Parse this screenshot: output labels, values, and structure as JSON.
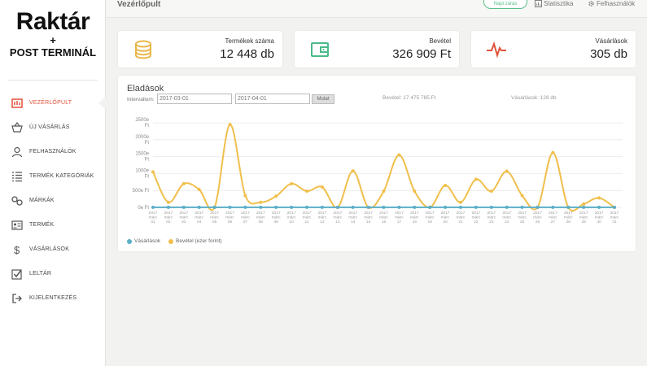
{
  "sidebar": {
    "logo_main": "Raktár",
    "logo_plus": "+",
    "logo_sub": "POST TERMINÁL",
    "items": [
      {
        "label": "VEZÉRLŐPULT",
        "icon": "dashboard-icon"
      },
      {
        "label": "ÚJ VÁSÁRLÁS",
        "icon": "basket-icon"
      },
      {
        "label": "FELHASZNÁLÓK",
        "icon": "user-icon"
      },
      {
        "label": "TERMÉK KATEGÓRIÁK",
        "icon": "list-icon"
      },
      {
        "label": "MÁRKÁK",
        "icon": "link-icon"
      },
      {
        "label": "TERMÉK",
        "icon": "id-card-icon"
      },
      {
        "label": "VÁSÁRLÁSOK",
        "icon": "dollar-icon"
      },
      {
        "label": "LELTÁR",
        "icon": "checkbox-icon"
      },
      {
        "label": "KIJELENTKEZÉS",
        "icon": "logout-icon"
      }
    ]
  },
  "topbar": {
    "title": "Vezérlőpult",
    "napi_zaras": "Napi zárás",
    "statisztika": "Statisztika",
    "felhasznalok": "Felhasználók"
  },
  "cards": [
    {
      "label": "Termékek száma",
      "value": "12 448 db",
      "icon": "coins-icon",
      "color": "#e8b84a"
    },
    {
      "label": "Bevétel",
      "value": "326 909 Ft",
      "icon": "wallet-icon",
      "color": "#4cb98a"
    },
    {
      "label": "Vásárlások",
      "value": "305 db",
      "icon": "pulse-icon",
      "color": "#e2523a"
    }
  ],
  "sales": {
    "title": "Eladások",
    "interval_label": "Intervallum:",
    "date_from": "2017-03-01",
    "date_to": "2017-04-01",
    "show_button": "Mutat",
    "revenue_summary": "Bevétel: 17 475 785 Ft",
    "purchases_summary": "Vásárlások: 128 db",
    "legend_purchases": "Vásárlások",
    "legend_revenue": "Bevétel (ezer forint)"
  },
  "chart_data": {
    "type": "line",
    "y_ticks": [
      "0e Ft",
      "500e Ft",
      "1000e Ft",
      "1500e Ft",
      "2000e Ft",
      "2500e Ft"
    ],
    "ylim": [
      0,
      2500
    ],
    "x": [
      "2017 márc 01",
      "2017 márc 02",
      "2017 márc 03",
      "2017 márc 04",
      "2017 márc 05",
      "2017 márc 06",
      "2017 márc 07",
      "2017 márc 08",
      "2017 márc 09",
      "2017 márc 10",
      "2017 márc 11",
      "2017 márc 12",
      "2017 márc 13",
      "2017 márc 14",
      "2017 márc 15",
      "2017 márc 16",
      "2017 márc 17",
      "2017 márc 18",
      "2017 márc 19",
      "2017 márc 20",
      "2017 márc 21",
      "2017 márc 22",
      "2017 márc 23",
      "2017 márc 24",
      "2017 márc 25",
      "2017 márc 26",
      "2017 márc 27",
      "2017 márc 28",
      "2017 márc 29",
      "2017 márc 30",
      "2017 márc 31"
    ],
    "tick_top": "2017",
    "tick_mid": "márc",
    "tick_days": [
      "01",
      "02",
      "03",
      "04",
      "05",
      "06",
      "07",
      "08",
      "09",
      "10",
      "11",
      "12",
      "13",
      "14",
      "15",
      "16",
      "17",
      "18",
      "19",
      "20",
      "21",
      "22",
      "23",
      "24",
      "25",
      "26",
      "27",
      "28",
      "29",
      "30",
      "31"
    ],
    "series": [
      {
        "name": "Vásárlások",
        "color": "#5aaec8",
        "values": [
          4,
          4,
          4,
          4,
          4,
          4,
          4,
          4,
          4,
          4,
          4,
          4,
          4,
          4,
          4,
          4,
          4,
          4,
          4,
          4,
          4,
          4,
          4,
          4,
          4,
          4,
          4,
          4,
          4,
          4,
          4
        ]
      },
      {
        "name": "Bevétel (ezer forint)",
        "color": "#f0bf4c",
        "values": [
          1050,
          150,
          700,
          530,
          0,
          2450,
          350,
          150,
          330,
          700,
          480,
          600,
          0,
          1080,
          0,
          480,
          1550,
          480,
          0,
          650,
          150,
          830,
          480,
          1070,
          350,
          0,
          1620,
          0,
          100,
          280,
          0
        ]
      }
    ]
  }
}
